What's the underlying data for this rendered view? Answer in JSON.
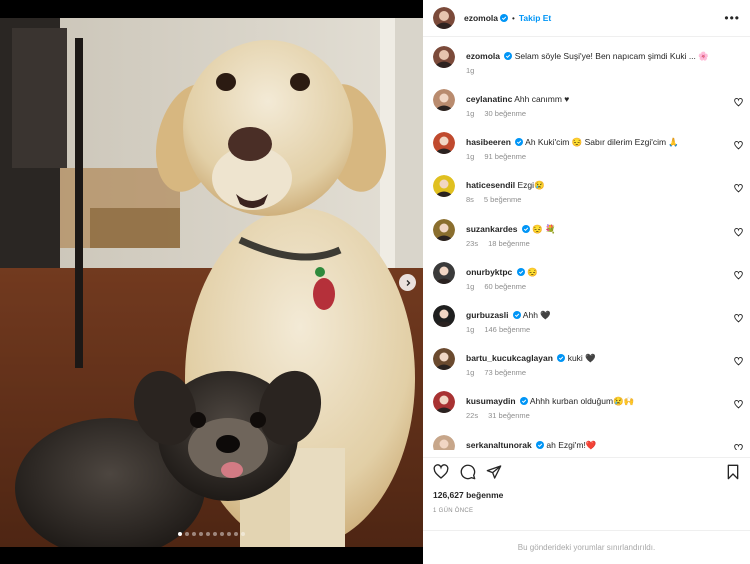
{
  "post": {
    "author": "ezomola",
    "follow_label": "Takip Et",
    "separator": "•",
    "more_icon": "more-horizontal-icon",
    "caption": {
      "username": "ezomola",
      "text": "Selam söyle Suşi'ye! Ben napıcam şimdi Kuki ... 🌸",
      "time": "1g"
    },
    "likes": "126,627 beğenme",
    "posted": "1 GÜN ÖNCE",
    "comments_limited": "Bu gönderideki yorumlar sınırlandırıldı."
  },
  "comments": [
    {
      "username": "ceylanatinc",
      "verified": false,
      "text": "Ahh canımm ♥",
      "time": "1g",
      "likes": "30 beğenme"
    },
    {
      "username": "hasibeeren",
      "verified": true,
      "text": "Ah Kuki'cim 😔 Sabır dilerim Ezgi'cim 🙏",
      "time": "1g",
      "likes": "91 beğenme"
    },
    {
      "username": "haticesendil",
      "verified": false,
      "text": "Ezgi😢",
      "time": "8s",
      "likes": "5 beğenme"
    },
    {
      "username": "suzankardes",
      "verified": true,
      "text": "😔 💐",
      "time": "23s",
      "likes": "18 beğenme"
    },
    {
      "username": "onurbyktpc",
      "verified": true,
      "text": "😔",
      "time": "1g",
      "likes": "60 beğenme"
    },
    {
      "username": "gurbuzasli",
      "verified": true,
      "text": "Ahh 🖤",
      "time": "1g",
      "likes": "146 beğenme"
    },
    {
      "username": "bartu_kucukcaglayan",
      "verified": true,
      "text": "kuki 🖤",
      "time": "1g",
      "likes": "73 beğenme"
    },
    {
      "username": "kusumaydin",
      "verified": true,
      "text": "Ahhh kurban olduğum😢🙌",
      "time": "22s",
      "likes": "31 beğenme"
    },
    {
      "username": "serkanaltunorak",
      "verified": true,
      "text": "ah Ezgi'm!❤️",
      "time": "",
      "likes": ""
    }
  ],
  "carousel": {
    "count": 10,
    "active": 1
  },
  "colors": {
    "accent": "#0095f6",
    "verified": "#0095f6",
    "muted": "#8e8e8e",
    "text": "#262626"
  }
}
